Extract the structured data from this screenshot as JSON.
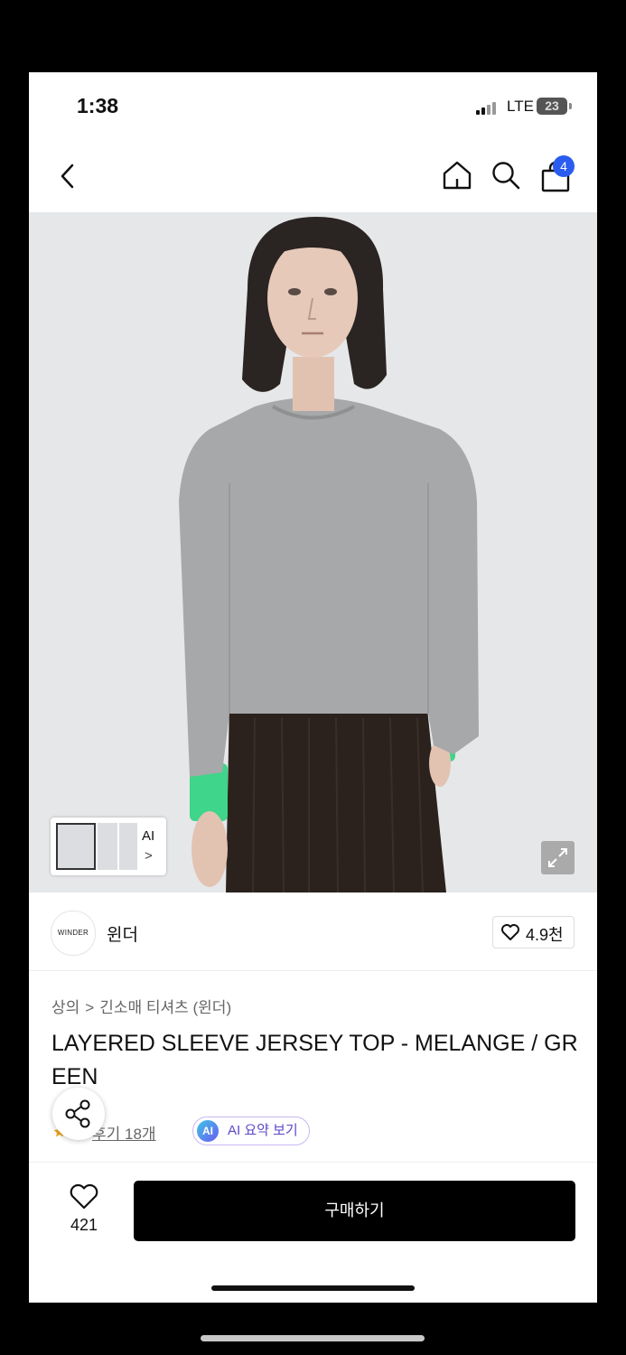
{
  "status": {
    "time": "1:38",
    "network": "LTE",
    "battery": "23"
  },
  "nav": {
    "back_icon": "chevron-left-icon",
    "home_icon": "home-icon",
    "search_icon": "search-icon",
    "cart_icon": "shopping-bag-icon",
    "cart_badge": "4"
  },
  "gallery": {
    "ai_label": "AI",
    "ai_arrow": ">",
    "expand_icon": "expand-icon"
  },
  "brand": {
    "logo_text": "WINDER",
    "name": "윈더",
    "like_count": "4.9천"
  },
  "breadcrumb": {
    "level1": "상의",
    "separator": ">",
    "level2": "긴소매 티셔츠 (윈더)"
  },
  "product": {
    "title": "LAYERED SLEEVE JERSEY TOP - MELANGE / GREEN"
  },
  "reviews": {
    "link_text": "후기 18개",
    "ai_badge": "AI",
    "ai_summary": "AI 요약 보기"
  },
  "bottom": {
    "wish_count": "421",
    "buy_label": "구매하기"
  },
  "colors": {
    "badge_blue": "#2a5cf0",
    "buy_button": "#000000",
    "ai_purple": "#5b47c8",
    "cuff_green": "#3fd58a"
  }
}
